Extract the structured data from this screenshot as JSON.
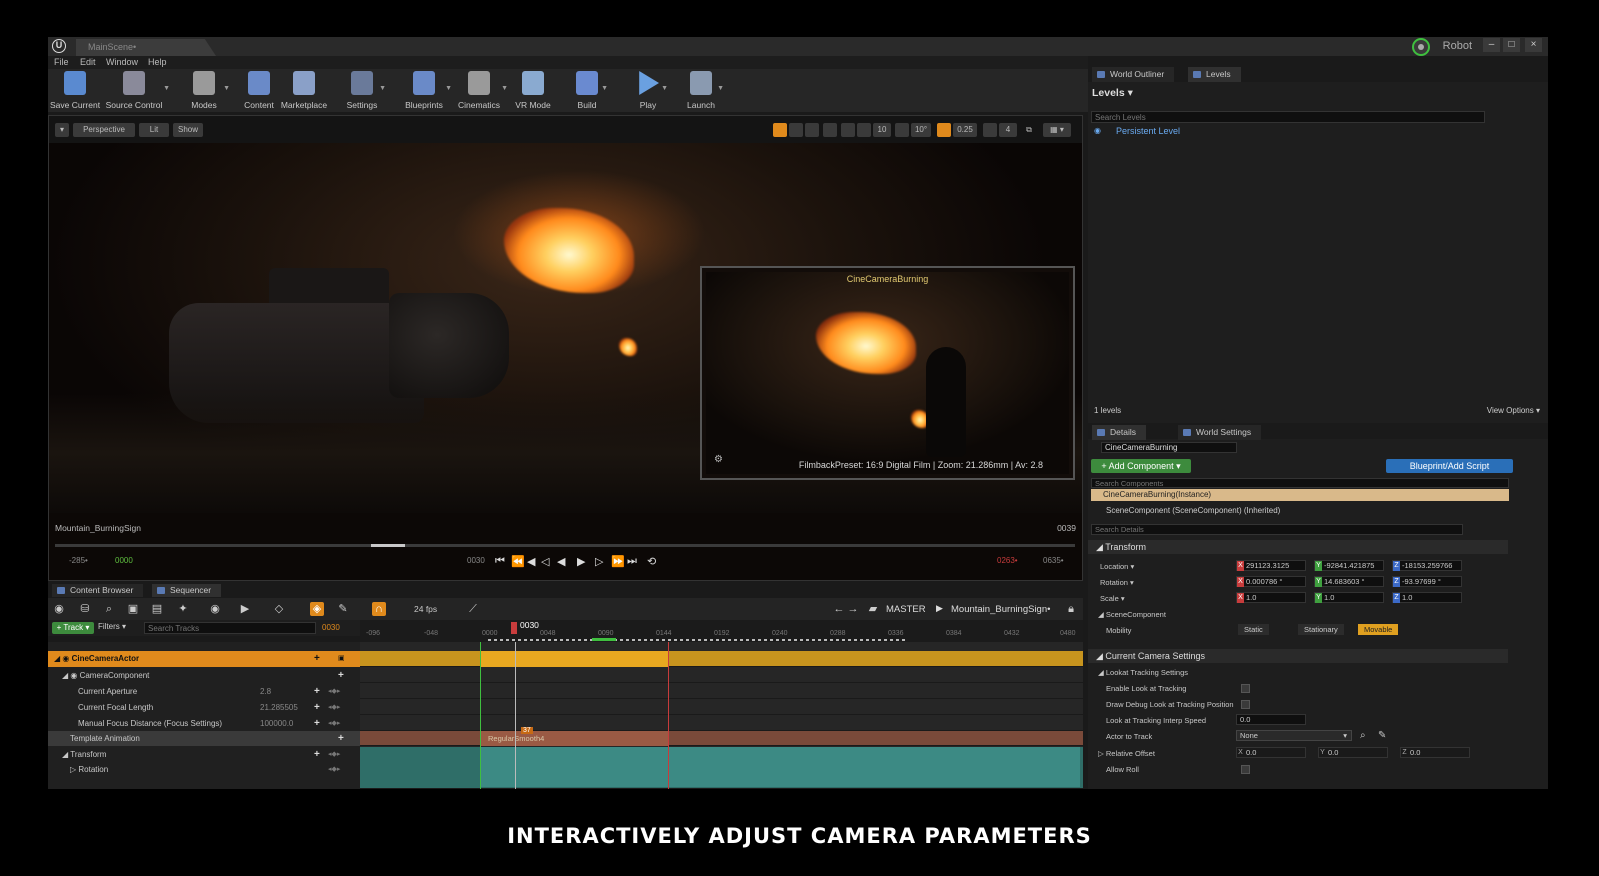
{
  "window": {
    "doc_tab": "MainScene•",
    "project": "Robot",
    "controls": {
      "minimize": "–",
      "maximize": "□",
      "close": "×"
    }
  },
  "menu": [
    "File",
    "Edit",
    "Window",
    "Help"
  ],
  "toolbar": [
    {
      "label": "Save Current",
      "icon": "save-icon",
      "color": "#5a8ad0"
    },
    {
      "label": "Source Control",
      "icon": "source-control-icon",
      "color": "#8a8a9a"
    },
    {
      "label": "Modes",
      "icon": "modes-icon",
      "color": "#9a9a9a"
    },
    {
      "label": "Content",
      "icon": "content-icon",
      "color": "#6a8ac8"
    },
    {
      "label": "Marketplace",
      "icon": "marketplace-icon",
      "color": "#8aa0c8"
    },
    {
      "label": "Settings",
      "icon": "settings-icon",
      "color": "#6a7a9a"
    },
    {
      "label": "Blueprints",
      "icon": "blueprints-icon",
      "color": "#6a8ac8"
    },
    {
      "label": "Cinematics",
      "icon": "cinematics-icon",
      "color": "#9a9a9a"
    },
    {
      "label": "VR Mode",
      "icon": "vr-mode-icon",
      "color": "#8aaad0"
    },
    {
      "label": "Build",
      "icon": "build-icon",
      "color": "#6a8ad0"
    },
    {
      "label": "Play",
      "icon": "play-icon",
      "color": "#6aa0e0"
    },
    {
      "label": "Launch",
      "icon": "launch-icon",
      "color": "#8a9ab0"
    }
  ],
  "viewport": {
    "perspective": "Perspective",
    "lit": "Lit",
    "show": "Show",
    "right_values": [
      "10",
      "10°",
      "0.25",
      "4"
    ],
    "pip_title": "CineCameraBurning",
    "filmback": "FilmbackPreset: 16:9 Digital Film | Zoom: 21.286mm | Av: 2.8",
    "level_name": "Mountain_BurningSign",
    "frame_end": "0039",
    "transport": {
      "start_outer": "-285•",
      "start_inner": "0000",
      "current": "0030",
      "end_inner": "0263•",
      "end_outer": "0635•"
    }
  },
  "bottom_tabs": [
    "Content Browser",
    "Sequencer"
  ],
  "sequencer": {
    "fps": "24 fps",
    "breadcrumb_root": "MASTER",
    "breadcrumb_seq": "Mountain_BurningSign•",
    "track_button": "+ Track ▾",
    "filters_button": "Filters ▾",
    "search_placeholder": "Search Tracks",
    "filter_frame": "0030",
    "playhead_frame": "0030",
    "ruler_ticks": [
      "-096",
      "-048",
      "0000",
      "0048",
      "0090",
      "0144",
      "0192",
      "0240",
      "0288",
      "0336",
      "0384",
      "0432",
      "0480"
    ],
    "tracks": [
      {
        "name": "CineCameraActor",
        "value": ""
      },
      {
        "name": "CameraComponent",
        "value": ""
      },
      {
        "name": "Current Aperture",
        "value": "2.8"
      },
      {
        "name": "Current Focal Length",
        "value": "21.285505"
      },
      {
        "name": "Manual Focus Distance (Focus Settings)",
        "value": "100000.0"
      },
      {
        "name": "Template Animation",
        "value": ""
      },
      {
        "name": "Transform",
        "value": ""
      },
      {
        "name": "Rotation",
        "value": ""
      }
    ],
    "section_label": "RegularSmooth4",
    "key_badge": "37"
  },
  "world_outliner": {
    "tabs": [
      "World Outliner",
      "Levels"
    ],
    "levels_header": "Levels ▾",
    "search_placeholder": "Search Levels",
    "persistent_level": "Persistent Level",
    "levels_count": "1 levels",
    "view_options": "View Options ▾"
  },
  "details": {
    "tabs": [
      "Details",
      "World Settings"
    ],
    "actor_name": "CineCameraBurning",
    "add_component": "+ Add Component ▾",
    "blueprint_script": "Blueprint/Add Script",
    "search_components": "Search Components",
    "instance": "CineCameraBurning(Instance)",
    "scene_component": "SceneComponent (SceneComponent) (Inherited)",
    "search_details": "Search Details",
    "transform_header": "Transform",
    "location_label": "Location ▾",
    "location": [
      "291123.3125",
      "-92841.421875",
      "-18153.259766"
    ],
    "rotation_label": "Rotation ▾",
    "rotation": [
      "0.000786 °",
      "14.683603 °",
      "-93.97699 °"
    ],
    "scale_label": "Scale ▾",
    "scale": [
      "1.0",
      "1.0",
      "1.0"
    ],
    "scene_comp_header": "SceneComponent",
    "mobility_label": "Mobility",
    "mobility_options": [
      "Static",
      "Stationary",
      "Movable"
    ],
    "cam_settings_header": "Current Camera Settings",
    "lookat_header": "Lookat Tracking Settings",
    "enable_lookat": "Enable Look at Tracking",
    "draw_debug": "Draw Debug Look at Tracking Position",
    "interp_speed_label": "Look at Tracking Interp Speed",
    "interp_speed": "0.0",
    "actor_to_track_label": "Actor to Track",
    "actor_to_track": "None",
    "relative_offset_label": "Relative Offset",
    "relative_offset": [
      "0.0",
      "0.0",
      "0.0"
    ],
    "allow_roll": "Allow Roll"
  },
  "caption": "INTERACTIVELY ADJUST CAMERA PARAMETERS"
}
